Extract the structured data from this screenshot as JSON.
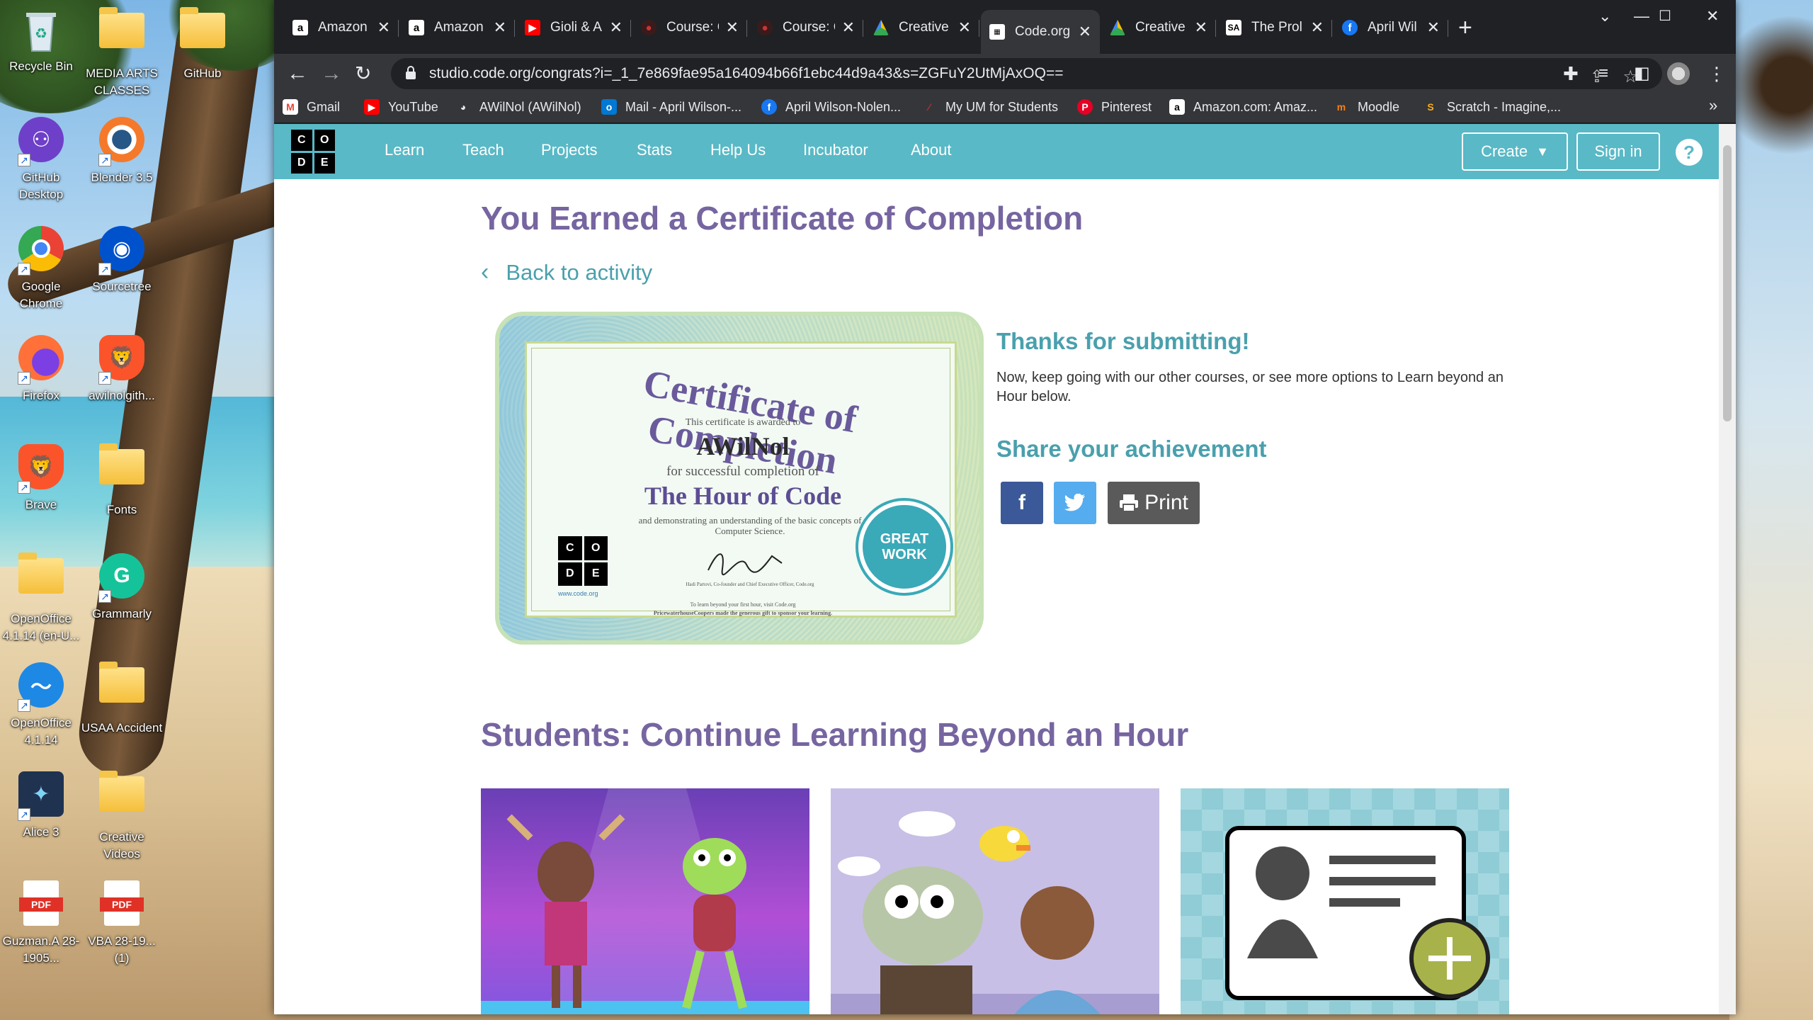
{
  "desktop": {
    "icons": [
      {
        "label": "Recycle Bin",
        "icon": "recycle-bin-icon"
      },
      {
        "label": "MEDIA ARTS CLASSES",
        "icon": "folder-icon"
      },
      {
        "label": "GitHub",
        "icon": "folder-icon"
      },
      {
        "label": "GitHub Desktop",
        "icon": "github-desktop-icon"
      },
      {
        "label": "Blender 3.5",
        "icon": "blender-icon"
      },
      {
        "label": "Google Chrome",
        "icon": "chrome-icon"
      },
      {
        "label": "Sourcetree",
        "icon": "sourcetree-icon"
      },
      {
        "label": "Firefox",
        "icon": "firefox-icon"
      },
      {
        "label": "awilnolgith...",
        "icon": "brave-icon"
      },
      {
        "label": "Brave",
        "icon": "brave-icon"
      },
      {
        "label": "Fonts",
        "icon": "folder-icon"
      },
      {
        "label": "OpenOffice 4.1.14 (en-U...",
        "icon": "folder-icon"
      },
      {
        "label": "Grammarly",
        "icon": "grammarly-icon"
      },
      {
        "label": "OpenOffice 4.1.14",
        "icon": "openoffice-icon"
      },
      {
        "label": "USAA Accident",
        "icon": "folder-icon"
      },
      {
        "label": "Alice 3",
        "icon": "alice-icon"
      },
      {
        "label": "Creative Videos",
        "icon": "folder-icon"
      },
      {
        "label": "Guzman.A 28-1905...",
        "icon": "pdf-icon"
      },
      {
        "label": "VBA 28-19... (1)",
        "icon": "pdf-icon"
      }
    ]
  },
  "browser": {
    "tabs": [
      {
        "title": "Amazon",
        "favicon": "amazon-icon"
      },
      {
        "title": "Amazon",
        "favicon": "amazon-icon"
      },
      {
        "title": "Gioli & A",
        "favicon": "youtube-icon"
      },
      {
        "title": "Course: C",
        "favicon": "moodle-icon"
      },
      {
        "title": "Course: C",
        "favicon": "moodle-icon"
      },
      {
        "title": "Creative",
        "favicon": "drive-icon"
      },
      {
        "title": "Code.org",
        "favicon": "code-org-icon"
      },
      {
        "title": "Creative",
        "favicon": "drive-icon"
      },
      {
        "title": "The Prol",
        "favicon": "sa-icon"
      },
      {
        "title": "April Wil",
        "favicon": "facebook-icon"
      }
    ],
    "new_tab": "+",
    "url": "studio.code.org/congrats?i=_1_7e869fae95a164094b66f1ebc44d9a43&s=ZGFuY2UtMjAxOQ==",
    "bookmarks": [
      {
        "label": "Gmail"
      },
      {
        "label": "YouTube"
      },
      {
        "label": "AWilNol (AWilNol)"
      },
      {
        "label": "Mail - April Wilson-..."
      },
      {
        "label": "April Wilson-Nolen..."
      },
      {
        "label": "My UM for Students"
      },
      {
        "label": "Pinterest"
      },
      {
        "label": "Amazon.com: Amaz..."
      },
      {
        "label": "Moodle"
      },
      {
        "label": "Scratch - Imagine,..."
      }
    ],
    "bookmarks_more": "»"
  },
  "site": {
    "logo_letters": [
      "C",
      "O",
      "D",
      "E"
    ],
    "nav": [
      "Learn",
      "Teach",
      "Projects",
      "Stats",
      "Help Us",
      "Incubator",
      "About"
    ],
    "create_label": "Create",
    "signin_label": "Sign in",
    "help_label": "?"
  },
  "main": {
    "title": "You Earned a Certificate of Completion",
    "back_label": "Back to activity",
    "certificate": {
      "heading": "Certificate of Completion",
      "awarded_to": "This certificate is awarded to",
      "name": "AWilNol",
      "for_completion": "for successful completion of",
      "course": "The Hour of Code",
      "demonstrating": "and demonstrating an understanding of the basic concepts of Computer Science.",
      "signer": "Hadi Partovi, Co-founder and Chief Executive Officer, Code.org",
      "site": "www.code.org",
      "learn_more": "To learn beyond your first hour, visit Code.org",
      "sponsor": "PricewaterhouseCoopers made the generous gift to sponsor your learning.",
      "badge": "GREAT WORK"
    },
    "thanks_title": "Thanks for submitting!",
    "thanks_body": "Now, keep going with our other courses, or see more options to Learn beyond an Hour below.",
    "share_title": "Share your achievement",
    "print_label": "Print",
    "students_title": "Students: Continue Learning Beyond an Hour"
  },
  "colors": {
    "header": "#59b9c6",
    "heading_purple": "#7665a0",
    "teal_text": "#4aa0ad",
    "facebook": "#3b5998",
    "twitter": "#55acee",
    "print": "#5a5a5a"
  }
}
